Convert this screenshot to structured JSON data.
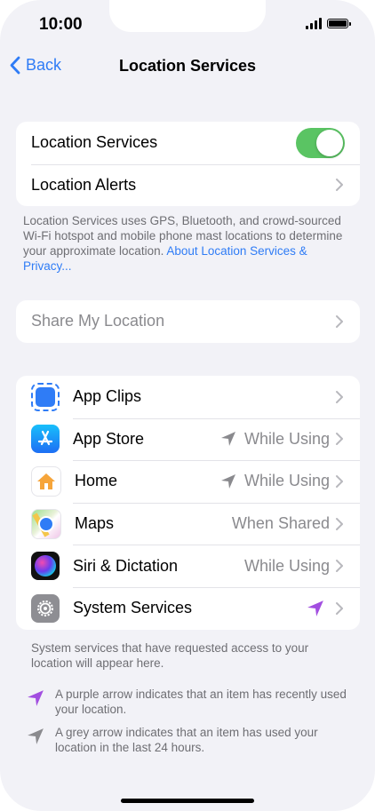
{
  "status_bar": {
    "time": "10:00"
  },
  "nav": {
    "back_label": "Back",
    "title": "Location Services"
  },
  "main_group": {
    "location_services_label": "Location Services",
    "location_services_on": true,
    "location_alerts_label": "Location Alerts"
  },
  "description": {
    "text": "Location Services uses GPS, Bluetooth, and crowd-sourced Wi-Fi hotspot and mobile phone mast locations to determine your approximate location. ",
    "link": "About Location Services & Privacy..."
  },
  "share_my_location": {
    "label": "Share My Location"
  },
  "apps": [
    {
      "name": "App Clips",
      "icon": "app-clips-icon",
      "value": "",
      "arrow": ""
    },
    {
      "name": "App Store",
      "icon": "app-store-icon",
      "value": "While Using",
      "arrow": "grey"
    },
    {
      "name": "Home",
      "icon": "home-icon",
      "value": "While Using",
      "arrow": "grey"
    },
    {
      "name": "Maps",
      "icon": "maps-icon",
      "value": "When Shared",
      "arrow": ""
    },
    {
      "name": "Siri & Dictation",
      "icon": "siri-icon",
      "value": "While Using",
      "arrow": ""
    },
    {
      "name": "System Services",
      "icon": "gear-icon",
      "value": "",
      "arrow": "purple"
    }
  ],
  "system_note": "System services that have requested access to your location will appear here.",
  "legend": {
    "purple": "A purple arrow indicates that an item has recently used your location.",
    "grey": "A grey arrow indicates that an item has used your location in the last 24 hours."
  },
  "colors": {
    "accent": "#2f7cf6",
    "toggle_on": "#5ac463",
    "purple_arrow": "#a24ee0",
    "grey_arrow": "#8a8a8e"
  }
}
